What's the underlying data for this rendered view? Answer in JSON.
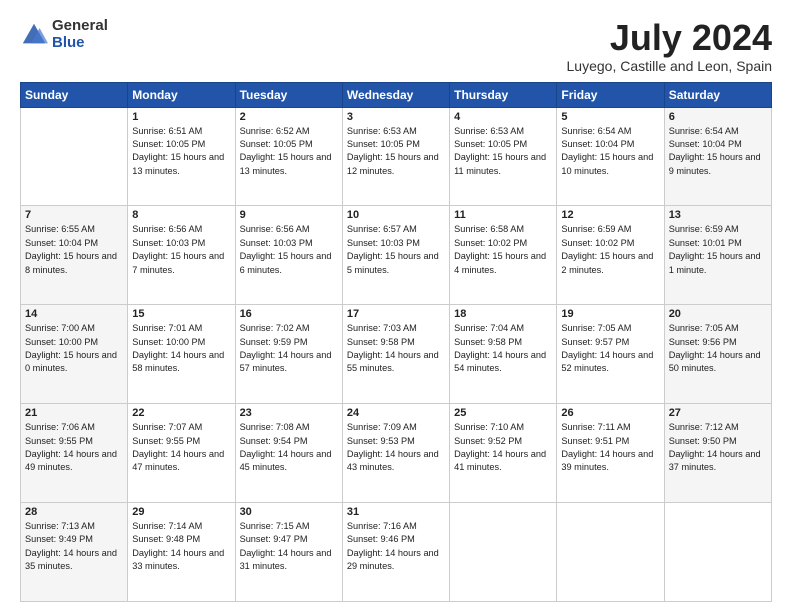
{
  "header": {
    "logo_general": "General",
    "logo_blue": "Blue",
    "month_title": "July 2024",
    "location": "Luyego, Castille and Leon, Spain"
  },
  "weekdays": [
    "Sunday",
    "Monday",
    "Tuesday",
    "Wednesday",
    "Thursday",
    "Friday",
    "Saturday"
  ],
  "weeks": [
    [
      {
        "day": "",
        "sunrise": "",
        "sunset": "",
        "daylight": "",
        "weekend": false,
        "empty": true
      },
      {
        "day": "1",
        "sunrise": "Sunrise: 6:51 AM",
        "sunset": "Sunset: 10:05 PM",
        "daylight": "Daylight: 15 hours and 13 minutes.",
        "weekend": false
      },
      {
        "day": "2",
        "sunrise": "Sunrise: 6:52 AM",
        "sunset": "Sunset: 10:05 PM",
        "daylight": "Daylight: 15 hours and 13 minutes.",
        "weekend": false
      },
      {
        "day": "3",
        "sunrise": "Sunrise: 6:53 AM",
        "sunset": "Sunset: 10:05 PM",
        "daylight": "Daylight: 15 hours and 12 minutes.",
        "weekend": false
      },
      {
        "day": "4",
        "sunrise": "Sunrise: 6:53 AM",
        "sunset": "Sunset: 10:05 PM",
        "daylight": "Daylight: 15 hours and 11 minutes.",
        "weekend": false
      },
      {
        "day": "5",
        "sunrise": "Sunrise: 6:54 AM",
        "sunset": "Sunset: 10:04 PM",
        "daylight": "Daylight: 15 hours and 10 minutes.",
        "weekend": false
      },
      {
        "day": "6",
        "sunrise": "Sunrise: 6:54 AM",
        "sunset": "Sunset: 10:04 PM",
        "daylight": "Daylight: 15 hours and 9 minutes.",
        "weekend": true
      }
    ],
    [
      {
        "day": "7",
        "sunrise": "Sunrise: 6:55 AM",
        "sunset": "Sunset: 10:04 PM",
        "daylight": "Daylight: 15 hours and 8 minutes.",
        "weekend": true
      },
      {
        "day": "8",
        "sunrise": "Sunrise: 6:56 AM",
        "sunset": "Sunset: 10:03 PM",
        "daylight": "Daylight: 15 hours and 7 minutes.",
        "weekend": false
      },
      {
        "day": "9",
        "sunrise": "Sunrise: 6:56 AM",
        "sunset": "Sunset: 10:03 PM",
        "daylight": "Daylight: 15 hours and 6 minutes.",
        "weekend": false
      },
      {
        "day": "10",
        "sunrise": "Sunrise: 6:57 AM",
        "sunset": "Sunset: 10:03 PM",
        "daylight": "Daylight: 15 hours and 5 minutes.",
        "weekend": false
      },
      {
        "day": "11",
        "sunrise": "Sunrise: 6:58 AM",
        "sunset": "Sunset: 10:02 PM",
        "daylight": "Daylight: 15 hours and 4 minutes.",
        "weekend": false
      },
      {
        "day": "12",
        "sunrise": "Sunrise: 6:59 AM",
        "sunset": "Sunset: 10:02 PM",
        "daylight": "Daylight: 15 hours and 2 minutes.",
        "weekend": false
      },
      {
        "day": "13",
        "sunrise": "Sunrise: 6:59 AM",
        "sunset": "Sunset: 10:01 PM",
        "daylight": "Daylight: 15 hours and 1 minute.",
        "weekend": true
      }
    ],
    [
      {
        "day": "14",
        "sunrise": "Sunrise: 7:00 AM",
        "sunset": "Sunset: 10:00 PM",
        "daylight": "Daylight: 15 hours and 0 minutes.",
        "weekend": true
      },
      {
        "day": "15",
        "sunrise": "Sunrise: 7:01 AM",
        "sunset": "Sunset: 10:00 PM",
        "daylight": "Daylight: 14 hours and 58 minutes.",
        "weekend": false
      },
      {
        "day": "16",
        "sunrise": "Sunrise: 7:02 AM",
        "sunset": "Sunset: 9:59 PM",
        "daylight": "Daylight: 14 hours and 57 minutes.",
        "weekend": false
      },
      {
        "day": "17",
        "sunrise": "Sunrise: 7:03 AM",
        "sunset": "Sunset: 9:58 PM",
        "daylight": "Daylight: 14 hours and 55 minutes.",
        "weekend": false
      },
      {
        "day": "18",
        "sunrise": "Sunrise: 7:04 AM",
        "sunset": "Sunset: 9:58 PM",
        "daylight": "Daylight: 14 hours and 54 minutes.",
        "weekend": false
      },
      {
        "day": "19",
        "sunrise": "Sunrise: 7:05 AM",
        "sunset": "Sunset: 9:57 PM",
        "daylight": "Daylight: 14 hours and 52 minutes.",
        "weekend": false
      },
      {
        "day": "20",
        "sunrise": "Sunrise: 7:05 AM",
        "sunset": "Sunset: 9:56 PM",
        "daylight": "Daylight: 14 hours and 50 minutes.",
        "weekend": true
      }
    ],
    [
      {
        "day": "21",
        "sunrise": "Sunrise: 7:06 AM",
        "sunset": "Sunset: 9:55 PM",
        "daylight": "Daylight: 14 hours and 49 minutes.",
        "weekend": true
      },
      {
        "day": "22",
        "sunrise": "Sunrise: 7:07 AM",
        "sunset": "Sunset: 9:55 PM",
        "daylight": "Daylight: 14 hours and 47 minutes.",
        "weekend": false
      },
      {
        "day": "23",
        "sunrise": "Sunrise: 7:08 AM",
        "sunset": "Sunset: 9:54 PM",
        "daylight": "Daylight: 14 hours and 45 minutes.",
        "weekend": false
      },
      {
        "day": "24",
        "sunrise": "Sunrise: 7:09 AM",
        "sunset": "Sunset: 9:53 PM",
        "daylight": "Daylight: 14 hours and 43 minutes.",
        "weekend": false
      },
      {
        "day": "25",
        "sunrise": "Sunrise: 7:10 AM",
        "sunset": "Sunset: 9:52 PM",
        "daylight": "Daylight: 14 hours and 41 minutes.",
        "weekend": false
      },
      {
        "day": "26",
        "sunrise": "Sunrise: 7:11 AM",
        "sunset": "Sunset: 9:51 PM",
        "daylight": "Daylight: 14 hours and 39 minutes.",
        "weekend": false
      },
      {
        "day": "27",
        "sunrise": "Sunrise: 7:12 AM",
        "sunset": "Sunset: 9:50 PM",
        "daylight": "Daylight: 14 hours and 37 minutes.",
        "weekend": true
      }
    ],
    [
      {
        "day": "28",
        "sunrise": "Sunrise: 7:13 AM",
        "sunset": "Sunset: 9:49 PM",
        "daylight": "Daylight: 14 hours and 35 minutes.",
        "weekend": true
      },
      {
        "day": "29",
        "sunrise": "Sunrise: 7:14 AM",
        "sunset": "Sunset: 9:48 PM",
        "daylight": "Daylight: 14 hours and 33 minutes.",
        "weekend": false
      },
      {
        "day": "30",
        "sunrise": "Sunrise: 7:15 AM",
        "sunset": "Sunset: 9:47 PM",
        "daylight": "Daylight: 14 hours and 31 minutes.",
        "weekend": false
      },
      {
        "day": "31",
        "sunrise": "Sunrise: 7:16 AM",
        "sunset": "Sunset: 9:46 PM",
        "daylight": "Daylight: 14 hours and 29 minutes.",
        "weekend": false
      },
      {
        "day": "",
        "sunrise": "",
        "sunset": "",
        "daylight": "",
        "weekend": false,
        "empty": true
      },
      {
        "day": "",
        "sunrise": "",
        "sunset": "",
        "daylight": "",
        "weekend": false,
        "empty": true
      },
      {
        "day": "",
        "sunrise": "",
        "sunset": "",
        "daylight": "",
        "weekend": true,
        "empty": true
      }
    ]
  ]
}
